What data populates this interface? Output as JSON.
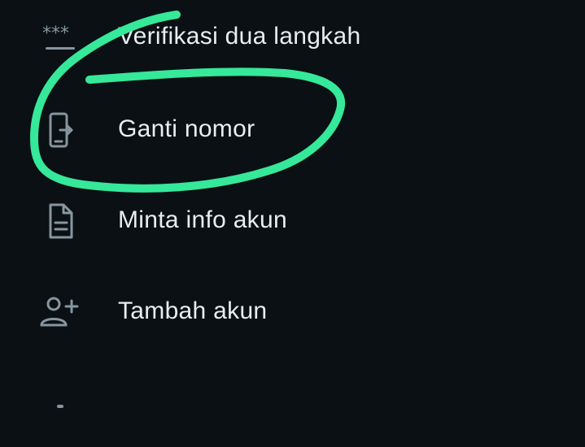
{
  "menu": {
    "items": [
      {
        "label": "Verifikasi dua langkah",
        "icon": "password-dots-icon"
      },
      {
        "label": "Ganti nomor",
        "icon": "phone-transfer-icon"
      },
      {
        "label": "Minta info akun",
        "icon": "document-icon"
      },
      {
        "label": "Tambah akun",
        "icon": "add-person-icon"
      },
      {
        "label": "",
        "icon": "partial-icon"
      }
    ]
  },
  "colors": {
    "background": "#0b1014",
    "text": "#e9edef",
    "icon": "#8696a0",
    "annotation": "#35e89a"
  }
}
